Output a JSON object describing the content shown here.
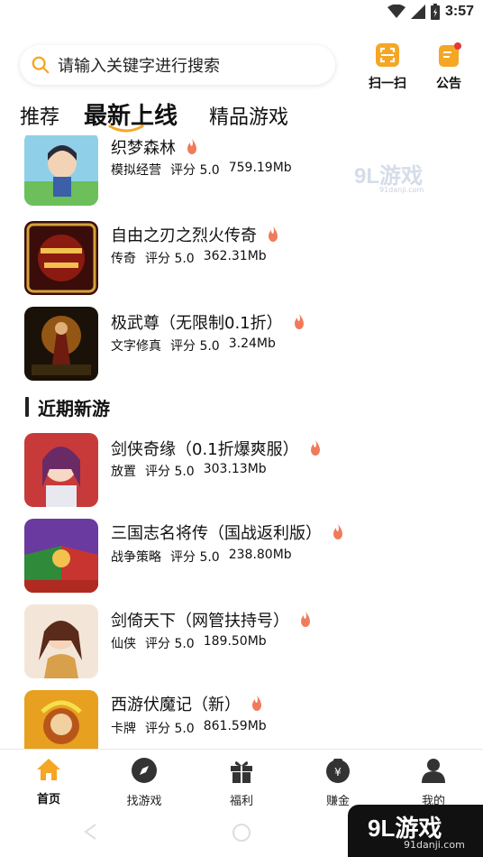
{
  "status_bar": {
    "time": "3:57"
  },
  "search": {
    "placeholder": "请输入关键字进行搜索"
  },
  "header_actions": {
    "scan_label": "扫一扫",
    "notice_label": "公告"
  },
  "tabs": [
    {
      "label": "推荐",
      "active": false
    },
    {
      "label": "最新上线",
      "active": true
    },
    {
      "label": "精品游戏",
      "active": false
    }
  ],
  "watermark": {
    "logo": "9L游戏",
    "url": "91danji.com"
  },
  "latest_games": [
    {
      "name": "织梦森林",
      "category": "模拟经营",
      "rating": "评分 5.0",
      "size": "759.19Mb",
      "hot": true,
      "icon": "forest-game-icon"
    },
    {
      "name": "自由之刃之烈火传奇",
      "category": "传奇",
      "rating": "评分 5.0",
      "size": "362.31Mb",
      "hot": true,
      "icon": "legend-game-icon"
    },
    {
      "name": "极武尊（无限制0.1折）",
      "category": "文字修真",
      "rating": "评分 5.0",
      "size": "3.24Mb",
      "hot": true,
      "icon": "martial-game-icon"
    }
  ],
  "section": {
    "title": "近期新游"
  },
  "recent_games": [
    {
      "name": "剑侠奇缘（0.1折爆爽服）",
      "category": "放置",
      "rating": "评分 5.0",
      "size": "303.13Mb",
      "hot": true,
      "icon": "swordsman-game-icon"
    },
    {
      "name": "三国志名将传（国战返利版）",
      "category": "战争策略",
      "rating": "评分 5.0",
      "size": "238.80Mb",
      "hot": true,
      "icon": "three-kingdoms-game-icon"
    },
    {
      "name": "剑倚天下（网管扶持号）",
      "category": "仙侠",
      "rating": "评分 5.0",
      "size": "189.50Mb",
      "hot": true,
      "icon": "sword-world-game-icon"
    },
    {
      "name": "西游伏魔记（新）",
      "category": "卡牌",
      "rating": "评分 5.0",
      "size": "861.59Mb",
      "hot": true,
      "icon": "journey-west-game-icon"
    }
  ],
  "bottom_nav": [
    {
      "label": "首页",
      "icon": "home-icon",
      "active": true
    },
    {
      "label": "找游戏",
      "icon": "compass-icon",
      "active": false
    },
    {
      "label": "福利",
      "icon": "gift-icon",
      "active": false
    },
    {
      "label": "赚金",
      "icon": "money-bag-icon",
      "active": false
    },
    {
      "label": "我的",
      "icon": "user-icon",
      "active": false
    }
  ],
  "corner_watermark": {
    "logo": "9L游戏",
    "url": "91danji.com"
  },
  "colors": {
    "accent": "#f5a623",
    "hot": "#f07b5b",
    "notice_dot": "#e53935"
  }
}
